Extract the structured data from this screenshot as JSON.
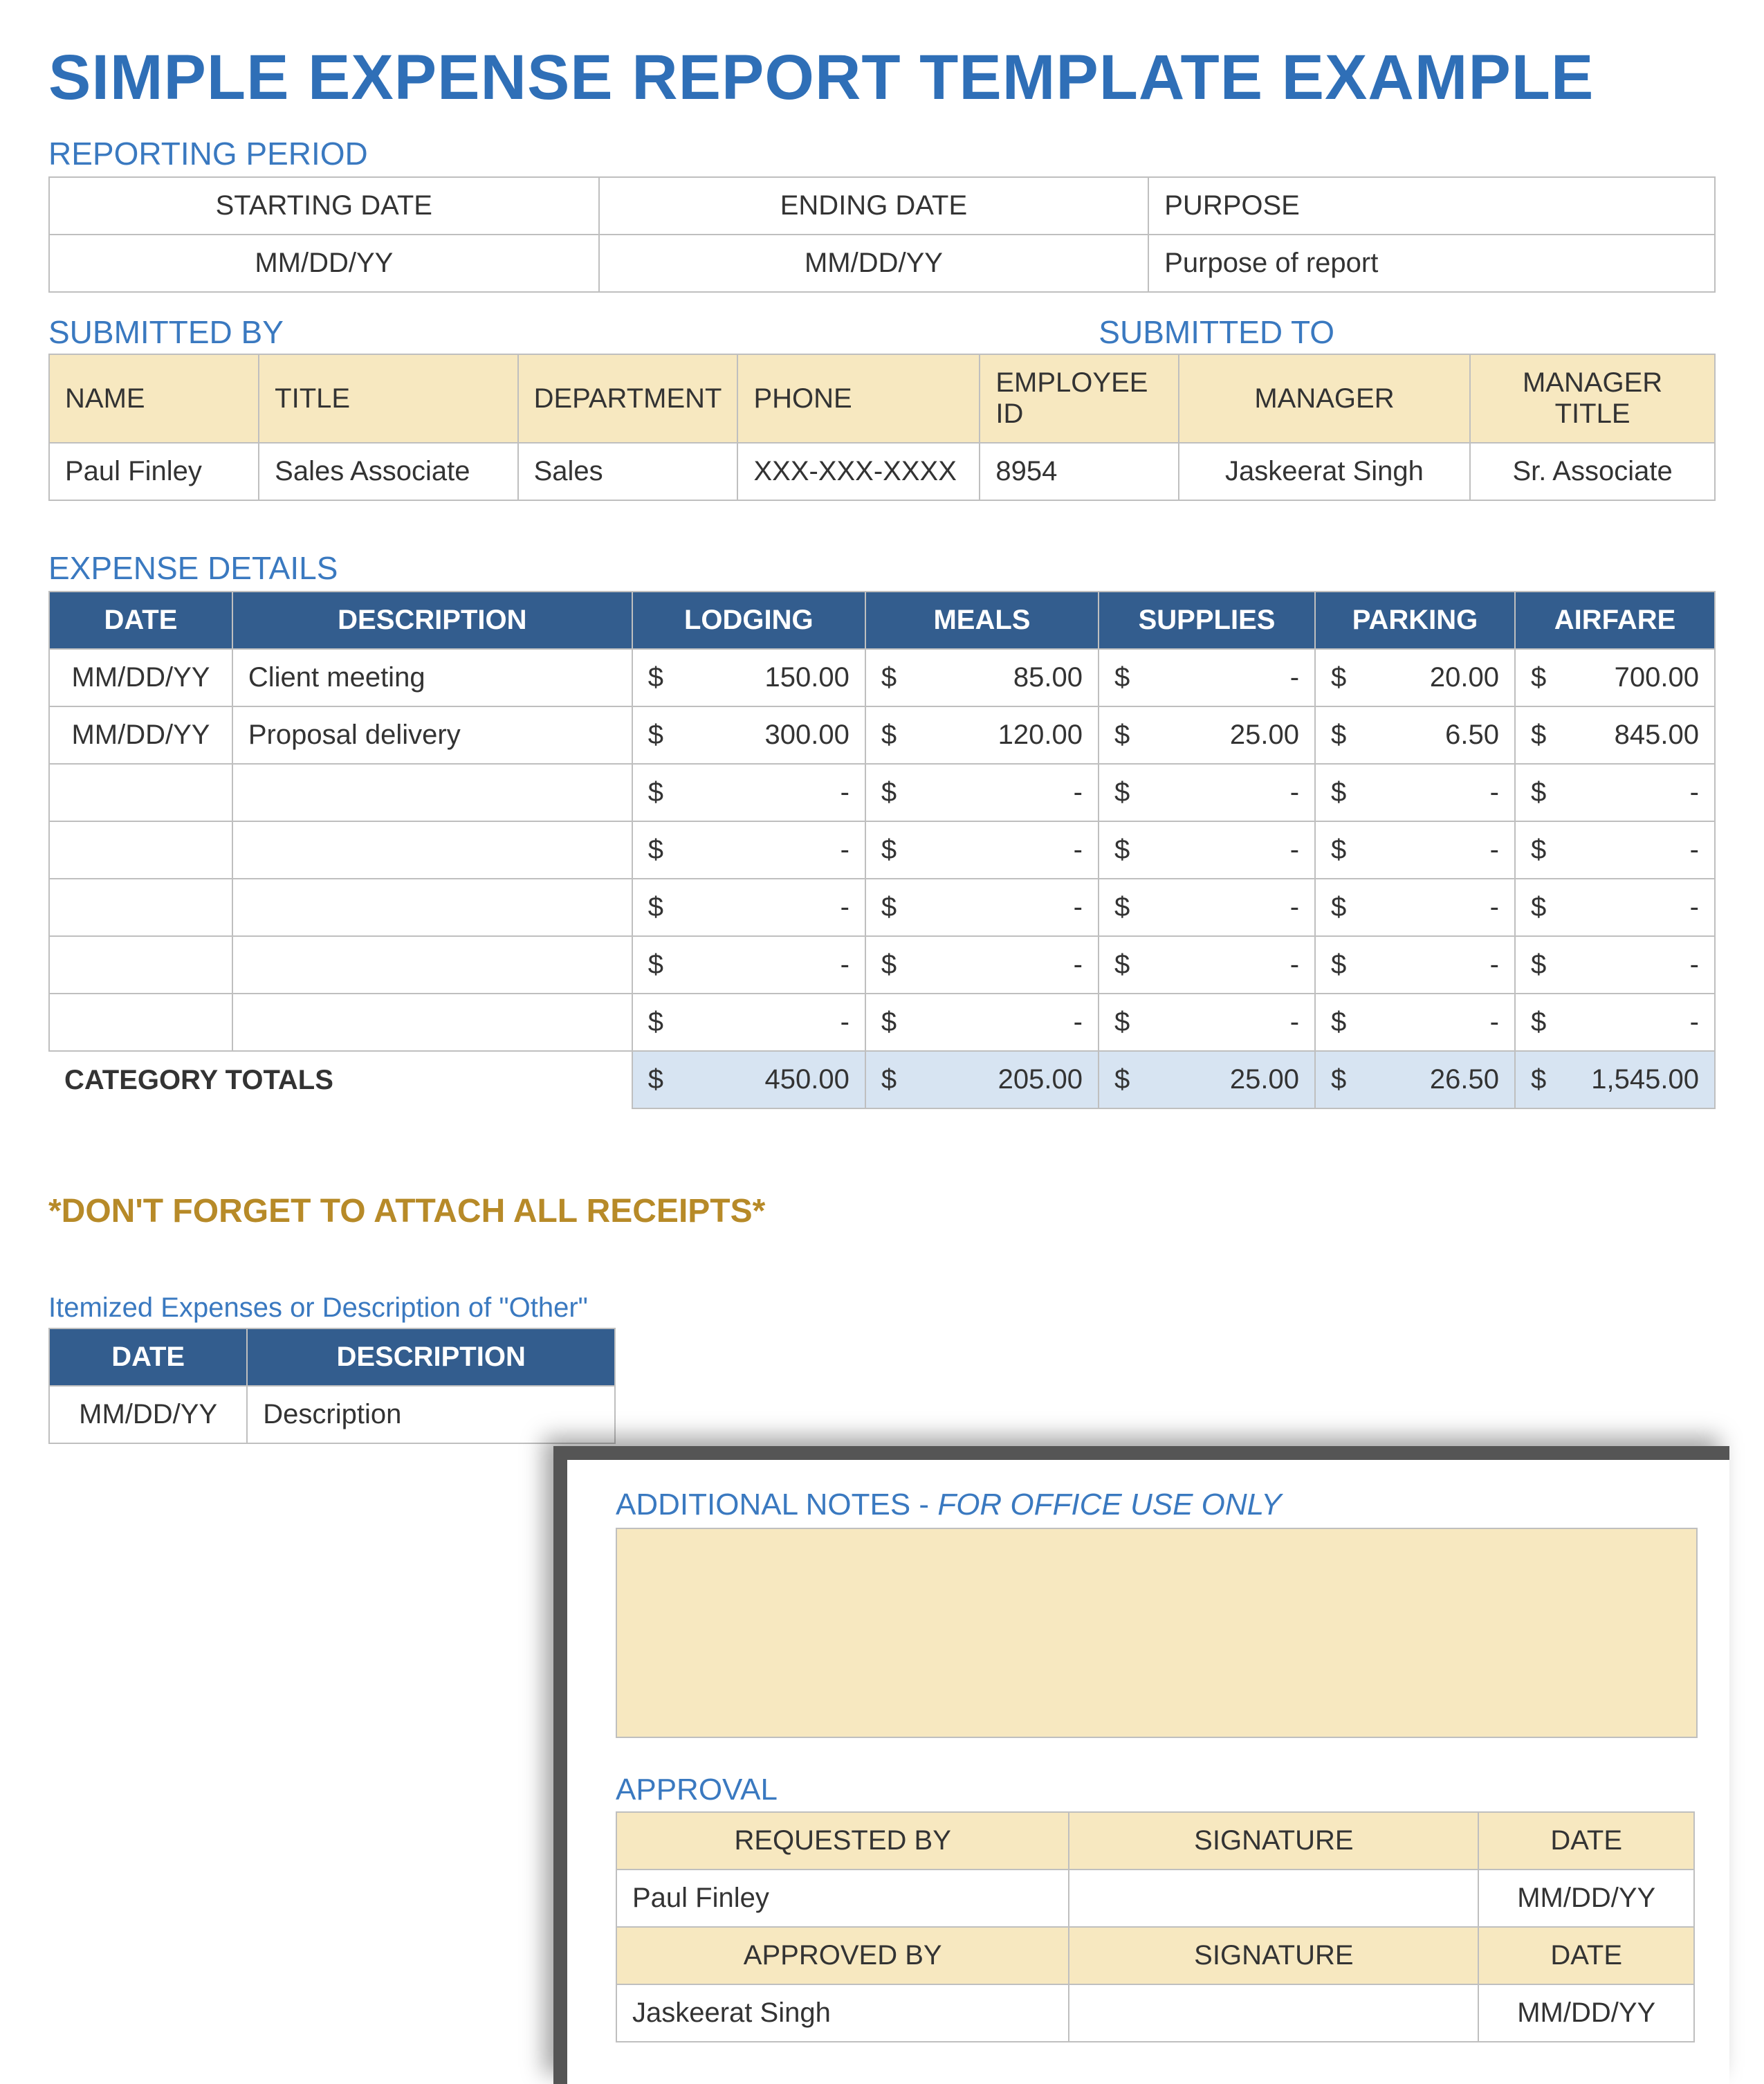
{
  "title": "SIMPLE EXPENSE REPORT TEMPLATE EXAMPLE",
  "reporting": {
    "label": "REPORTING PERIOD",
    "headers": {
      "start": "STARTING DATE",
      "end": "ENDING DATE",
      "purpose": "PURPOSE"
    },
    "values": {
      "start": "MM/DD/YY",
      "end": "MM/DD/YY",
      "purpose": "Purpose of report"
    }
  },
  "submitted": {
    "by_label": "SUBMITTED BY",
    "to_label": "SUBMITTED TO",
    "headers": {
      "name": "NAME",
      "title": "TITLE",
      "department": "DEPARTMENT",
      "phone": "PHONE",
      "employee_id": "EMPLOYEE ID",
      "manager": "MANAGER",
      "manager_title": "MANAGER TITLE"
    },
    "values": {
      "name": "Paul Finley",
      "title": "Sales Associate",
      "department": "Sales",
      "phone": "XXX-XXX-XXXX",
      "employee_id": "8954",
      "manager": "Jaskeerat Singh",
      "manager_title": "Sr. Associate"
    }
  },
  "expense": {
    "label": "EXPENSE DETAILS",
    "headers": {
      "date": "DATE",
      "description": "DESCRIPTION",
      "lodging": "LODGING",
      "meals": "MEALS",
      "supplies": "SUPPLIES",
      "parking": "PARKING",
      "airfare": "AIRFARE"
    },
    "currency": "$",
    "rows": [
      {
        "date": "MM/DD/YY",
        "description": "Client meeting",
        "lodging": "150.00",
        "meals": "85.00",
        "supplies": "-",
        "parking": "20.00",
        "airfare": "700.00"
      },
      {
        "date": "MM/DD/YY",
        "description": "Proposal delivery",
        "lodging": "300.00",
        "meals": "120.00",
        "supplies": "25.00",
        "parking": "6.50",
        "airfare": "845.00"
      },
      {
        "date": "",
        "description": "",
        "lodging": "-",
        "meals": "-",
        "supplies": "-",
        "parking": "-",
        "airfare": "-"
      },
      {
        "date": "",
        "description": "",
        "lodging": "-",
        "meals": "-",
        "supplies": "-",
        "parking": "-",
        "airfare": "-"
      },
      {
        "date": "",
        "description": "",
        "lodging": "-",
        "meals": "-",
        "supplies": "-",
        "parking": "-",
        "airfare": "-"
      },
      {
        "date": "",
        "description": "",
        "lodging": "-",
        "meals": "-",
        "supplies": "-",
        "parking": "-",
        "airfare": "-"
      },
      {
        "date": "",
        "description": "",
        "lodging": "-",
        "meals": "-",
        "supplies": "-",
        "parking": "-",
        "airfare": "-"
      }
    ],
    "totals_label": "CATEGORY TOTALS",
    "totals": {
      "lodging": "450.00",
      "meals": "205.00",
      "supplies": "25.00",
      "parking": "26.50",
      "airfare": "1,545.00"
    }
  },
  "receipts_note": "*DON'T FORGET TO ATTACH ALL RECEIPTS*",
  "itemized": {
    "label": "Itemized Expenses or Description of \"Other\"",
    "headers": {
      "date": "DATE",
      "description": "DESCRIPTION"
    },
    "row": {
      "date": "MM/DD/YY",
      "description": "Description"
    }
  },
  "inset": {
    "notes_label": "ADDITIONAL NOTES - ",
    "notes_sub": "FOR OFFICE USE ONLY",
    "approval_label": "APPROVAL",
    "headers": {
      "requested": "REQUESTED BY",
      "signature": "SIGNATURE",
      "date": "DATE",
      "approved": "APPROVED BY"
    },
    "requested": {
      "name": "Paul Finley",
      "signature": "",
      "date": "MM/DD/YY"
    },
    "approved": {
      "name": "Jaskeerat Singh",
      "signature": "",
      "date": "MM/DD/YY"
    }
  }
}
